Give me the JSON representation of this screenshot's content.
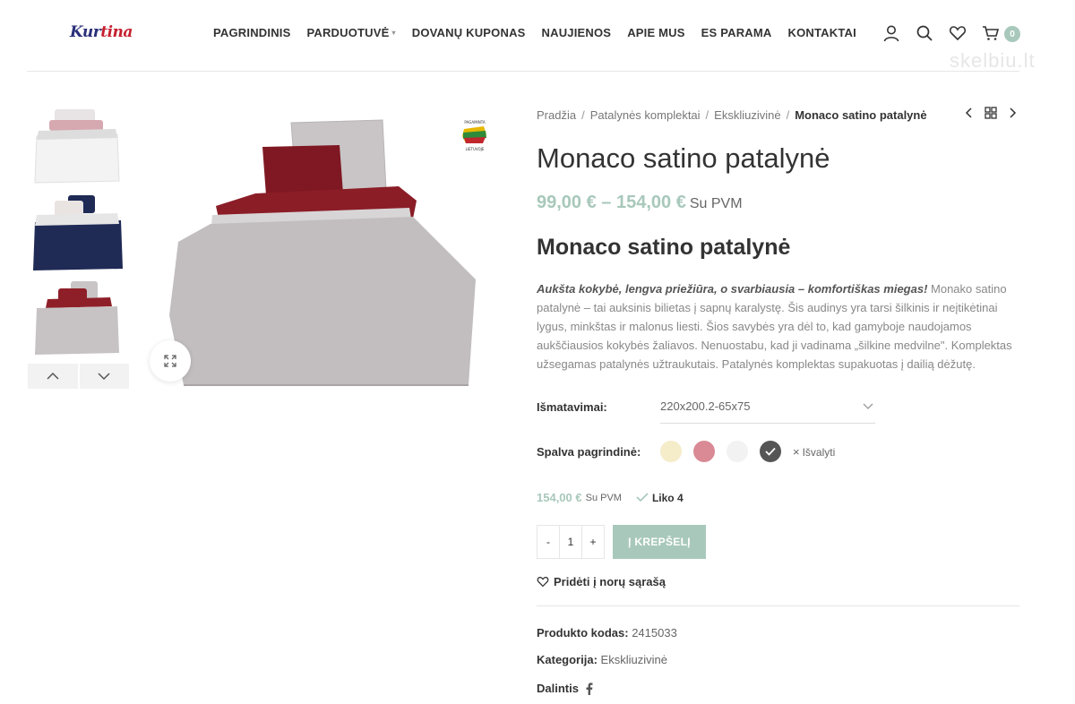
{
  "header": {
    "logo_main": "Kur",
    "logo_accent": "tina",
    "nav": [
      {
        "label": "PAGRINDINIS"
      },
      {
        "label": "PARDUOTUVĖ"
      },
      {
        "label": "DOVANŲ KUPONAS"
      },
      {
        "label": "NAUJIENOS"
      },
      {
        "label": "APIE MUS"
      },
      {
        "label": "ES PARAMA"
      },
      {
        "label": "KONTAKTAI"
      }
    ],
    "cart_count": "0",
    "watermark": "skelbiu.lt"
  },
  "gallery": {
    "thumbnails": [
      "white-grey bedding",
      "navy bedding",
      "grey-burgundy bedding"
    ],
    "badge_text": "PAGAMINTA LIETUVOJE"
  },
  "breadcrumb": {
    "items": [
      "Pradžia",
      "Patalynės komplektai",
      "Ekskliuzivinė"
    ],
    "current": "Monaco satino patalynė"
  },
  "product": {
    "title": "Monaco satino patalynė",
    "price_range": "99,00 € – 154,00 €",
    "price_suffix": "Su PVM",
    "subtitle": "Monaco satino patalynė",
    "desc_lead": "Aukšta kokybė, lengva priežiūra, o svarbiausia – komfortiškas miegas!",
    "desc_body": " Monako satino patalynė – tai auksinis bilietas į sapnų karalystę. Šis audinys yra tarsi šilkinis  ir neįtikėtinai lygus, minkštas ir malonus liesti. Šios savybės yra dėl to, kad gamyboje naudojamos aukščiausios kokybės žaliavos. Nenuostabu, kad ji vadinama „šilkine medvilne\". Komplektas užsegamas patalynės užtraukutais. Patalynės komplektas supakuotas į dailią dėžutę."
  },
  "variations": {
    "size_label": "Išmatavimai:",
    "size_value": "220x200.2-65x75",
    "color_label": "Spalva pagrindinė:",
    "swatches": [
      {
        "color": "#f5ecc9",
        "selected": false
      },
      {
        "color": "#d98a95",
        "selected": false
      },
      {
        "color": "#f2f2f2",
        "selected": false
      },
      {
        "color": "#555555",
        "selected": true
      }
    ],
    "clear_label": "Išvalyti"
  },
  "variation_price": {
    "amount": "154,00 €",
    "suffix": "Su PVM",
    "stock": "Liko 4"
  },
  "cart": {
    "minus": "-",
    "qty": "1",
    "plus": "+",
    "add_label": "Į KREPŠELĮ"
  },
  "wishlist_label": "Pridėti į norų sąrašą",
  "meta": {
    "sku_label": "Produkto kodas:",
    "sku_value": "2415033",
    "category_label": "Kategorija:",
    "category_value": "Ekskliuzivinė",
    "share_label": "Dalintis"
  },
  "colors": {
    "accent": "#a8c8bb"
  }
}
